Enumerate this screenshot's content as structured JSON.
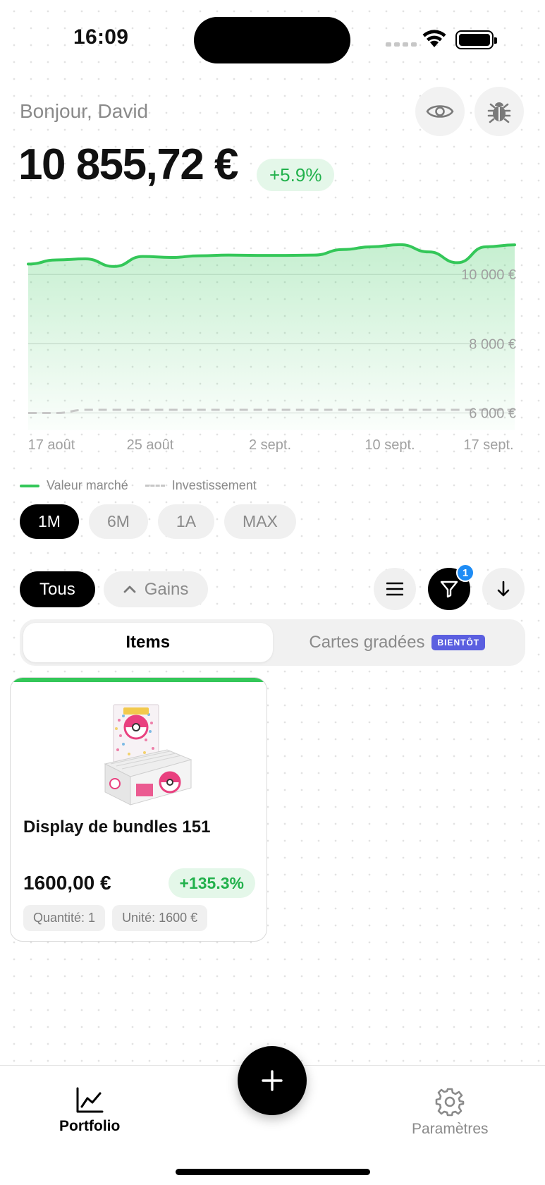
{
  "status": {
    "time": "16:09"
  },
  "header": {
    "greeting": "Bonjour, David",
    "total": "10 855,72 €",
    "change_pct": "+5.9%"
  },
  "chart_data": {
    "type": "area",
    "x": [
      "17 août",
      "25 août",
      "2 sept.",
      "10 sept.",
      "17 sept."
    ],
    "y_ticks": [
      "10 000 €",
      "8 000 €",
      "6 000 €"
    ],
    "ylim": [
      5500,
      11000
    ],
    "series": [
      {
        "name": "Valeur marché",
        "color": "#34c759",
        "values": [
          10300,
          10420,
          10450,
          10230,
          10520,
          10490,
          10540,
          10560,
          10550,
          10550,
          10560,
          10720,
          10800,
          10860,
          10650,
          10340,
          10800,
          10855
        ]
      },
      {
        "name": "Investissement",
        "color": "#c7c7c7",
        "values": [
          6000,
          6000,
          6090,
          6090,
          6090,
          6090,
          6090,
          6090,
          6090,
          6090,
          6090,
          6090,
          6090,
          6090,
          6090,
          6090,
          6090,
          6090
        ]
      }
    ],
    "legend": [
      "Valeur marché",
      "Investissement"
    ],
    "grid": true
  },
  "ranges": [
    {
      "label": "1M",
      "active": true
    },
    {
      "label": "6M",
      "active": false
    },
    {
      "label": "1A",
      "active": false
    },
    {
      "label": "MAX",
      "active": false
    }
  ],
  "filters": {
    "all_label": "Tous",
    "gains_label": "Gains",
    "filter_count": "1"
  },
  "tabs": {
    "items": "Items",
    "graded": "Cartes gradées",
    "soon_badge": "BIENTÔT"
  },
  "card": {
    "name": "Display de bundles 151",
    "price": "1600,00 €",
    "gain": "+135.3%",
    "quantity": "Quantité: 1",
    "unit": "Unité: 1600 €",
    "accent": "#34c759"
  },
  "nav": {
    "portfolio": "Portfolio",
    "settings": "Paramètres"
  }
}
